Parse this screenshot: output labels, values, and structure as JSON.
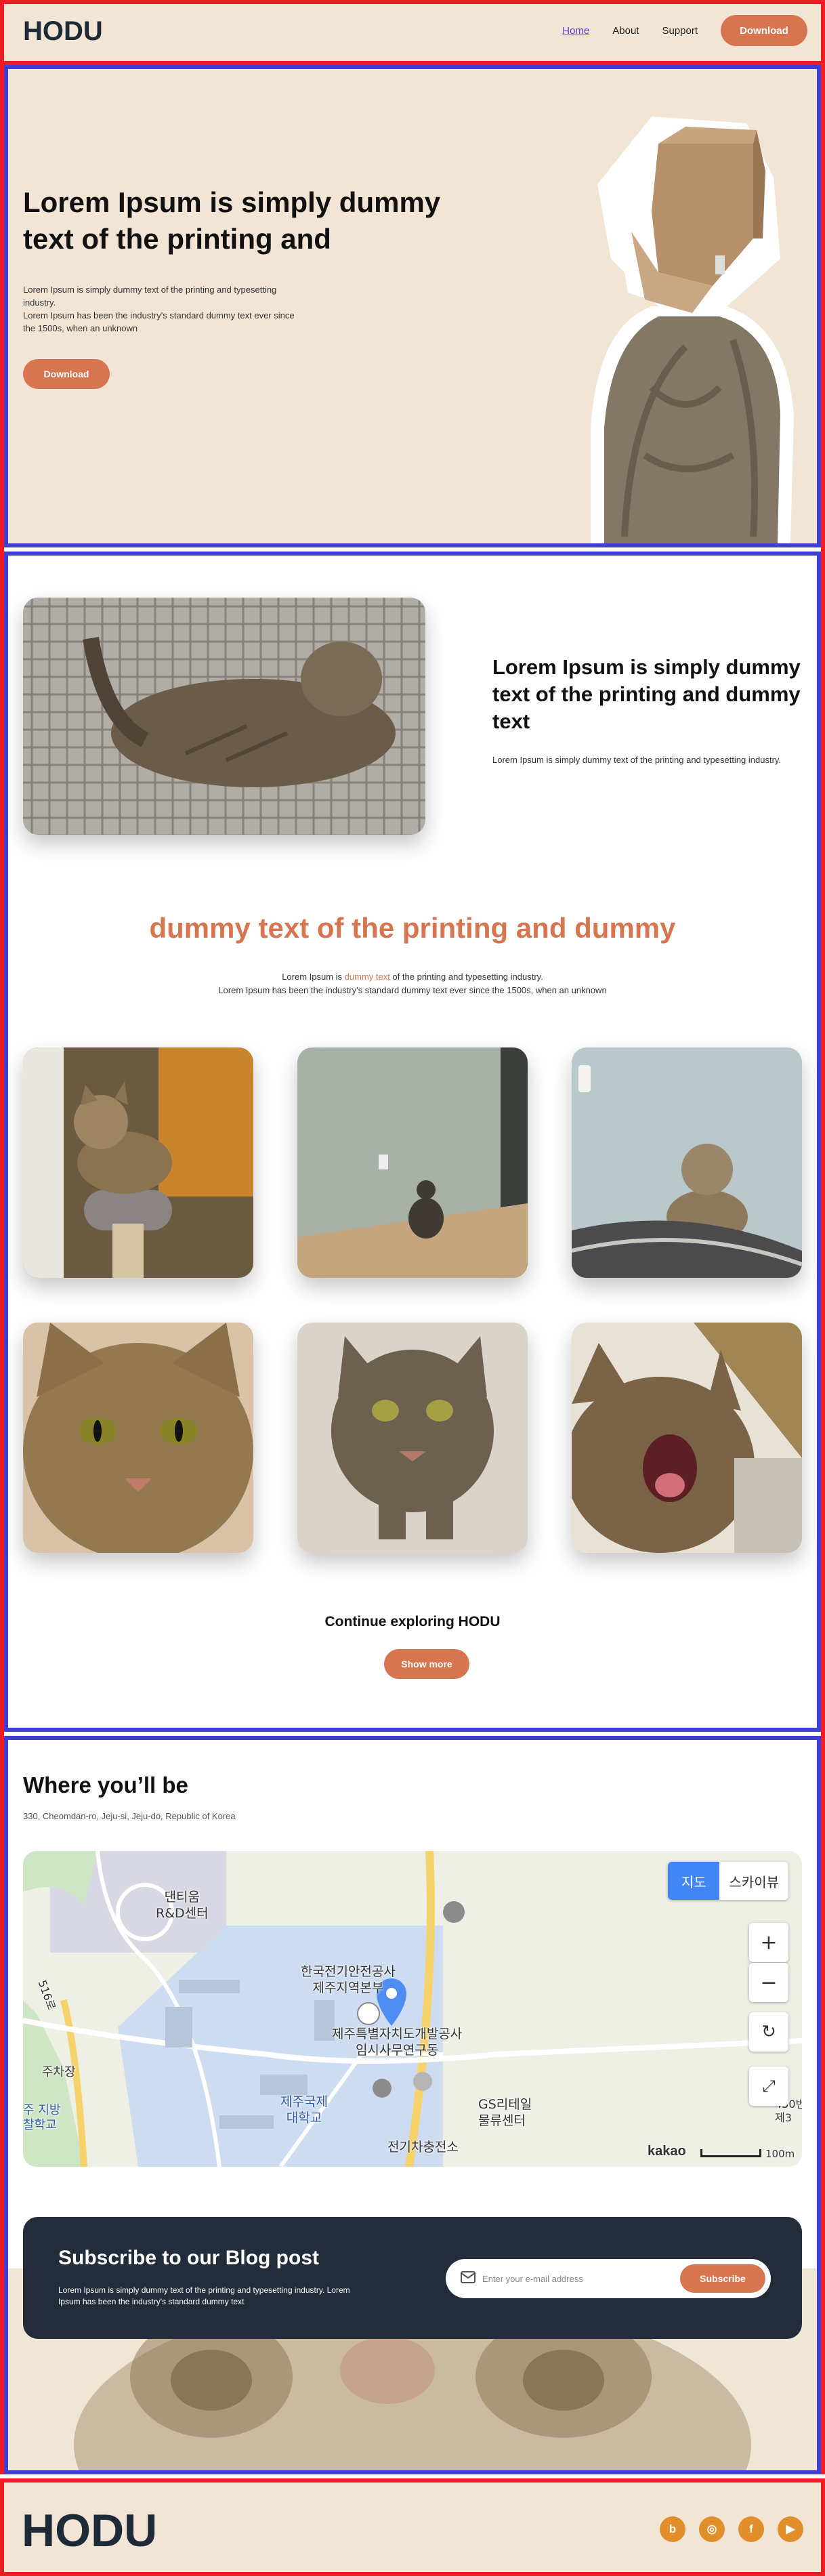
{
  "brand": {
    "logo_text": "HODU"
  },
  "nav": {
    "items": [
      {
        "label": "Home",
        "active": true
      },
      {
        "label": "About",
        "active": false
      },
      {
        "label": "Support",
        "active": false
      }
    ],
    "download_label": "Download"
  },
  "hero": {
    "title": "Lorem Ipsum is simply dummy text of the printing and",
    "description_1": "Lorem Ipsum is simply dummy text of the printing and typesetting industry.",
    "description_2": "Lorem Ipsum has been the industry's standard dummy text ever since the 1500s, when an unknown",
    "download_label": "Download",
    "image_icon": "cat-with-box-photo"
  },
  "about": {
    "title": "Lorem Ipsum is simply dummy text of the printing and dummy text",
    "description": "Lorem Ipsum is simply dummy text of the printing and typesetting industry.",
    "image_icon": "cat-lying-on-bed-photo"
  },
  "gallery_section": {
    "heading": "dummy text of the printing and dummy",
    "desc_prefix": "Lorem Ipsum is ",
    "desc_highlight": "dummy text",
    "desc_suffix": " of the printing and typesetting industry.",
    "desc_line2": "Lorem Ipsum has been the industry's standard dummy text ever since the 1500s, when an unknown",
    "photos": [
      "cat-on-scratching-post-photo",
      "cat-sitting-on-floor-photo",
      "cat-on-blanket-photo",
      "cat-face-closeup-photo",
      "cat-looking-up-photo",
      "cat-yawning-photo"
    ],
    "continue_title": "Continue exploring HODU",
    "show_more_label": "Show more"
  },
  "location": {
    "title": "Where you’ll be",
    "address": "330, Cheomdan-ro, Jeju-si, Jeju-do, Republic of Korea",
    "map": {
      "type_map": "지도",
      "type_skyview": "스카이뷰",
      "zoom_in": "+",
      "zoom_out": "−",
      "provider": "kakao",
      "scale": "100m",
      "labels": {
        "rnd": "댄티움\nR&D센터",
        "kepco": "한국전기안전공사\n제주지역본부",
        "jdc": "제주특별자치도개발공사\n임시사무연구동",
        "gs": "GS리테일\n물류센터",
        "university": "제주국제\n대학교",
        "charging": "전기차충전소",
        "parking": "주차장",
        "branch": "주 지방\n찰학교",
        "road": "516로",
        "edge": "430번\n제3"
      }
    }
  },
  "subscribe": {
    "title": "Subscribe to our Blog post",
    "description": "Lorem Ipsum is simply dummy text of the printing and typesetting industry. Lorem Ipsum has been the industry's standard dummy text",
    "placeholder": "Enter your e-mail address",
    "button_label": "Subscribe"
  },
  "footer": {
    "social": [
      {
        "icon": "blog-icon",
        "glyph": "b"
      },
      {
        "icon": "instagram-icon",
        "glyph": "◎"
      },
      {
        "icon": "facebook-icon",
        "glyph": "f"
      },
      {
        "icon": "youtube-icon",
        "glyph": "▶"
      }
    ]
  },
  "colors": {
    "accent": "#d77550",
    "header_bg": "#f2e5d5",
    "dark_panel": "#222c3b",
    "social": "#e28f2b",
    "map_button": "#4285f4"
  }
}
